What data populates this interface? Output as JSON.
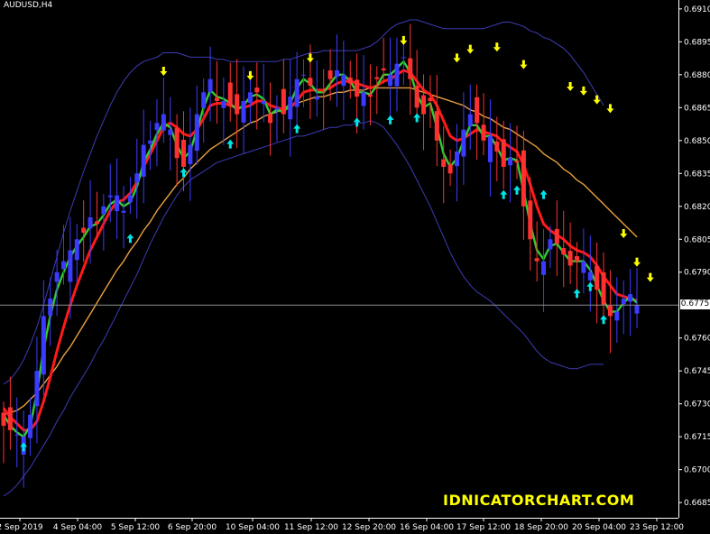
{
  "symbol_label": "AUDUSD,H4",
  "watermark": "IDNICATORCHART.COM",
  "current_price_label": "0.6775",
  "colors": {
    "background": "#000000",
    "bull_candle": "#3b3bff",
    "bear_candle": "#ff3030",
    "slow_ma": "#ff1a1a",
    "fast_ma": "#33cc33",
    "trend_ma": "#e8a040",
    "bands": "#3c3cb4",
    "sell_arrow": "#ffff00",
    "buy_arrow": "#00e5e5",
    "price_line": "#8c8c8c"
  },
  "chart_data": {
    "type": "candlestick",
    "y_ticks": [
      "0.6910",
      "0.6895",
      "0.6880",
      "0.6865",
      "0.6850",
      "0.6835",
      "0.6820",
      "0.6805",
      "0.6790",
      "0.6775",
      "0.6760",
      "0.6745",
      "0.6730",
      "0.6715",
      "0.6700",
      "0.6685"
    ],
    "ylim": [
      0.6683,
      0.6912
    ],
    "x_ticks": [
      "2 Sep 2019",
      "4 Sep 04:00",
      "5 Sep 12:00",
      "6 Sep 20:00",
      "10 Sep 04:00",
      "11 Sep 12:00",
      "12 Sep 20:00",
      "16 Sep 04:00",
      "17 Sep 12:00",
      "18 Sep 20:00",
      "20 Sep 04:00",
      "23 Sep 12:00"
    ],
    "current_price": 0.6775,
    "close": [
      0.672,
      0.6718,
      0.6716,
      0.6715,
      0.6725,
      0.6745,
      0.677,
      0.6778,
      0.679,
      0.6795,
      0.68,
      0.6805,
      0.6808,
      0.6815,
      0.6812,
      0.682,
      0.6825,
      0.6825,
      0.6818,
      0.6825,
      0.6835,
      0.6848,
      0.685,
      0.6858,
      0.6862,
      0.6855,
      0.6842,
      0.6838,
      0.6848,
      0.6862,
      0.6872,
      0.6878,
      0.6868,
      0.6868,
      0.6866,
      0.6862,
      0.6868,
      0.6872,
      0.6872,
      0.6868,
      0.6858,
      0.6865,
      0.6862,
      0.687,
      0.6878,
      0.688,
      0.6875,
      0.687,
      0.6872,
      0.6878,
      0.6882,
      0.688,
      0.6876,
      0.687,
      0.6872,
      0.687,
      0.6878,
      0.6882,
      0.688,
      0.6885,
      0.6888,
      0.6878,
      0.6865,
      0.6862,
      0.6868,
      0.685,
      0.6838,
      0.6835,
      0.6845,
      0.6855,
      0.6862,
      0.6858,
      0.685,
      0.6852,
      0.6845,
      0.6838,
      0.6842,
      0.684,
      0.682,
      0.6805,
      0.6795,
      0.6795,
      0.6805,
      0.6803,
      0.6798,
      0.6793,
      0.6795,
      0.6795,
      0.679,
      0.6782,
      0.6775,
      0.677,
      0.6772,
      0.6778,
      0.678,
      0.6775
    ],
    "fast_ma": [
      0.6725,
      0.672,
      0.6717,
      0.6715,
      0.672,
      0.6735,
      0.6755,
      0.677,
      0.6782,
      0.679,
      0.6797,
      0.6802,
      0.6806,
      0.6811,
      0.6812,
      0.6816,
      0.6821,
      0.6823,
      0.682,
      0.6822,
      0.6829,
      0.684,
      0.6846,
      0.6853,
      0.6858,
      0.6856,
      0.6848,
      0.6842,
      0.6845,
      0.6855,
      0.6865,
      0.6873,
      0.687,
      0.6869,
      0.6867,
      0.6864,
      0.6866,
      0.687,
      0.6871,
      0.6869,
      0.6862,
      0.6864,
      0.6863,
      0.6867,
      0.6874,
      0.6878,
      0.6876,
      0.6872,
      0.6872,
      0.6876,
      0.688,
      0.688,
      0.6877,
      0.6872,
      0.6872,
      0.6871,
      0.6875,
      0.688,
      0.688,
      0.6883,
      0.6886,
      0.6881,
      0.6871,
      0.6865,
      0.6867,
      0.6856,
      0.6844,
      0.6838,
      0.6842,
      0.685,
      0.6857,
      0.6857,
      0.6852,
      0.6852,
      0.6847,
      0.6841,
      0.6842,
      0.6841,
      0.6827,
      0.6812,
      0.68,
      0.6796,
      0.6802,
      0.6803,
      0.6799,
      0.6795,
      0.6795,
      0.6795,
      0.6791,
      0.6784,
      0.6777,
      0.6772,
      0.6772,
      0.6776,
      0.6779,
      0.6776
    ],
    "slow_ma": [
      0.6728,
      0.6724,
      0.6721,
      0.6718,
      0.6718,
      0.6722,
      0.6731,
      0.6742,
      0.6754,
      0.6765,
      0.6775,
      0.6784,
      0.6792,
      0.68,
      0.6806,
      0.6812,
      0.6818,
      0.6822,
      0.6823,
      0.6826,
      0.6831,
      0.6838,
      0.6844,
      0.685,
      0.6856,
      0.6858,
      0.6856,
      0.6853,
      0.6852,
      0.6855,
      0.686,
      0.6866,
      0.6867,
      0.6867,
      0.6866,
      0.6865,
      0.6865,
      0.6866,
      0.6868,
      0.6868,
      0.6866,
      0.6865,
      0.6864,
      0.6865,
      0.6868,
      0.6872,
      0.6873,
      0.6873,
      0.6873,
      0.6874,
      0.6876,
      0.6877,
      0.6877,
      0.6876,
      0.6875,
      0.6874,
      0.6875,
      0.6877,
      0.6878,
      0.688,
      0.6882,
      0.6881,
      0.6877,
      0.6873,
      0.6871,
      0.6866,
      0.6859,
      0.6852,
      0.685,
      0.6851,
      0.6853,
      0.6855,
      0.6854,
      0.6853,
      0.6852,
      0.6849,
      0.6847,
      0.6845,
      0.6839,
      0.683,
      0.682,
      0.6812,
      0.6809,
      0.6807,
      0.6805,
      0.6802,
      0.68,
      0.6799,
      0.6797,
      0.6793,
      0.6788,
      0.6784,
      0.678,
      0.6779,
      0.6778,
      0.6777
    ],
    "trend_ma": [
      0.6725,
      0.6726,
      0.6727,
      0.6729,
      0.6732,
      0.6735,
      0.6739,
      0.6743,
      0.6747,
      0.6752,
      0.6756,
      0.6761,
      0.6766,
      0.6771,
      0.6776,
      0.6781,
      0.6786,
      0.6791,
      0.6795,
      0.68,
      0.6804,
      0.6809,
      0.6813,
      0.6818,
      0.6822,
      0.6826,
      0.683,
      0.6833,
      0.6837,
      0.684,
      0.6843,
      0.6846,
      0.6848,
      0.685,
      0.6852,
      0.6854,
      0.6856,
      0.6858,
      0.6859,
      0.6861,
      0.6862,
      0.6863,
      0.6865,
      0.6866,
      0.6867,
      0.6868,
      0.6869,
      0.687,
      0.687,
      0.6871,
      0.6872,
      0.6872,
      0.6873,
      0.6873,
      0.6873,
      0.6874,
      0.6874,
      0.6874,
      0.6874,
      0.6874,
      0.6874,
      0.6874,
      0.6873,
      0.6872,
      0.6871,
      0.687,
      0.6869,
      0.6868,
      0.6867,
      0.6866,
      0.6864,
      0.6863,
      0.6861,
      0.686,
      0.6858,
      0.6856,
      0.6855,
      0.6853,
      0.6851,
      0.6849,
      0.6847,
      0.6844,
      0.6842,
      0.684,
      0.6837,
      0.6835,
      0.6832,
      0.683,
      0.6827,
      0.6824,
      0.6821,
      0.6818,
      0.6815,
      0.6812,
      0.6809,
      0.6806
    ],
    "upper_band": [
      0.6739,
      0.6741,
      0.6745,
      0.675,
      0.6757,
      0.6765,
      0.6775,
      0.6786,
      0.6797,
      0.6808,
      0.6818,
      0.6827,
      0.6836,
      0.6844,
      0.6852,
      0.6859,
      0.6866,
      0.6872,
      0.6877,
      0.6881,
      0.6884,
      0.6886,
      0.6887,
      0.6888,
      0.689,
      0.689,
      0.689,
      0.6889,
      0.6888,
      0.6888,
      0.6888,
      0.6888,
      0.6887,
      0.6887,
      0.6886,
      0.6886,
      0.6886,
      0.6886,
      0.6886,
      0.6886,
      0.6886,
      0.6886,
      0.6887,
      0.6887,
      0.6888,
      0.6889,
      0.689,
      0.689,
      0.6891,
      0.6891,
      0.6891,
      0.6891,
      0.6891,
      0.6891,
      0.6892,
      0.6893,
      0.6895,
      0.6898,
      0.6901,
      0.6903,
      0.6904,
      0.6905,
      0.6905,
      0.6904,
      0.6903,
      0.6902,
      0.6901,
      0.6901,
      0.6901,
      0.6901,
      0.6901,
      0.6901,
      0.6901,
      0.6902,
      0.6903,
      0.6904,
      0.6904,
      0.6903,
      0.6902,
      0.69,
      0.6899,
      0.6897,
      0.6896,
      0.6894,
      0.6892,
      0.6889,
      0.6885,
      0.6881,
      0.6876,
      0.6871,
      0.6866
    ],
    "lower_band": [
      0.6688,
      0.669,
      0.6693,
      0.6697,
      0.6701,
      0.6706,
      0.6711,
      0.6716,
      0.6722,
      0.6727,
      0.6733,
      0.6738,
      0.6743,
      0.6748,
      0.6754,
      0.6759,
      0.6765,
      0.6771,
      0.6777,
      0.6783,
      0.6789,
      0.6796,
      0.6803,
      0.6809,
      0.6815,
      0.682,
      0.6825,
      0.6829,
      0.6832,
      0.6834,
      0.6836,
      0.6838,
      0.684,
      0.6841,
      0.6842,
      0.6843,
      0.6844,
      0.6845,
      0.6846,
      0.6847,
      0.6848,
      0.6849,
      0.685,
      0.6851,
      0.6852,
      0.6852,
      0.6853,
      0.6854,
      0.6855,
      0.6856,
      0.6856,
      0.6857,
      0.6857,
      0.6858,
      0.6858,
      0.6859,
      0.6858,
      0.6856,
      0.6852,
      0.6848,
      0.6843,
      0.6838,
      0.6832,
      0.6826,
      0.682,
      0.6813,
      0.6806,
      0.6799,
      0.6793,
      0.6788,
      0.6784,
      0.6781,
      0.6779,
      0.6777,
      0.6774,
      0.6771,
      0.6768,
      0.6765,
      0.6762,
      0.6758,
      0.6754,
      0.6751,
      0.6749,
      0.6748,
      0.6747,
      0.6746,
      0.6746,
      0.6747,
      0.6748,
      0.6748,
      0.6748
    ],
    "sell_signals": [
      {
        "i": 24,
        "p": 0.6882
      },
      {
        "i": 37,
        "p": 0.688
      },
      {
        "i": 46,
        "p": 0.6888
      },
      {
        "i": 60,
        "p": 0.6896
      },
      {
        "i": 68,
        "p": 0.6888
      },
      {
        "i": 70,
        "p": 0.6892
      },
      {
        "i": 74,
        "p": 0.6893
      },
      {
        "i": 78,
        "p": 0.6885
      },
      {
        "i": 85,
        "p": 0.6875
      },
      {
        "i": 87,
        "p": 0.6873
      },
      {
        "i": 89,
        "p": 0.6869
      },
      {
        "i": 91,
        "p": 0.6865
      },
      {
        "i": 93,
        "p": 0.6808
      },
      {
        "i": 95,
        "p": 0.6795
      },
      {
        "i": 97,
        "p": 0.6788
      }
    ],
    "buy_signals": [
      {
        "i": 3,
        "p": 0.671
      },
      {
        "i": 19,
        "p": 0.6805
      },
      {
        "i": 27,
        "p": 0.6835
      },
      {
        "i": 34,
        "p": 0.6848
      },
      {
        "i": 44,
        "p": 0.6855
      },
      {
        "i": 53,
        "p": 0.6858
      },
      {
        "i": 58,
        "p": 0.6859
      },
      {
        "i": 62,
        "p": 0.686
      },
      {
        "i": 75,
        "p": 0.6825
      },
      {
        "i": 77,
        "p": 0.6827
      },
      {
        "i": 81,
        "p": 0.6825
      },
      {
        "i": 86,
        "p": 0.678
      },
      {
        "i": 88,
        "p": 0.6783
      },
      {
        "i": 90,
        "p": 0.6768
      }
    ]
  }
}
